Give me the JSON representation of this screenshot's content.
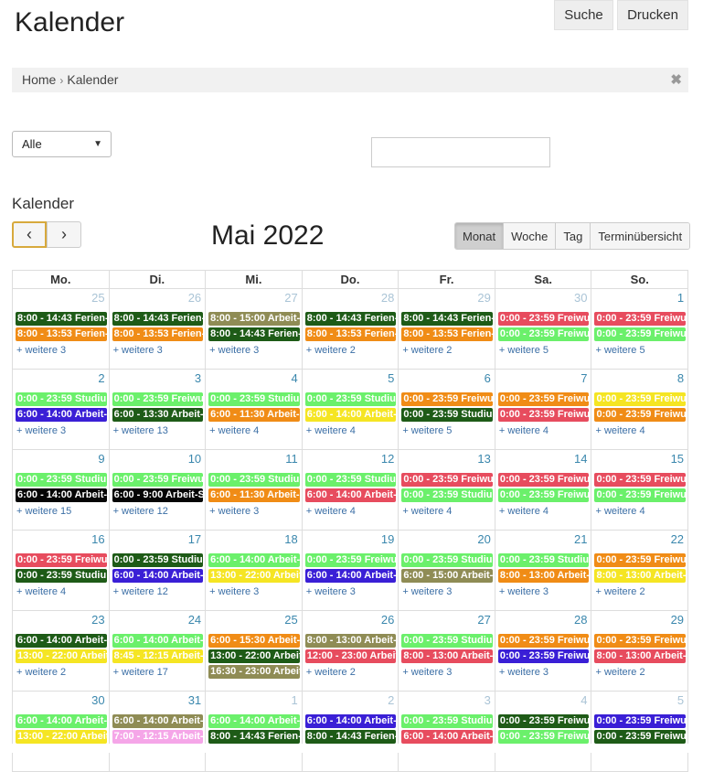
{
  "page": {
    "title": "Kalender"
  },
  "breadcrumb": {
    "home": "Home",
    "current": "Kalender",
    "close_icon": "close-icon"
  },
  "filter": {
    "selected": "Alle"
  },
  "search": {
    "value": "",
    "search_label": "Suche",
    "print_label": "Drucken"
  },
  "calendar": {
    "section_title": "Kalender",
    "month_title": "Mai 2022",
    "views": [
      "Monat",
      "Woche",
      "Tag",
      "Terminübersicht"
    ],
    "active_view": "Monat",
    "weekdays": [
      "Mo.",
      "Di.",
      "Mi.",
      "Do.",
      "Fr.",
      "Sa.",
      "So."
    ],
    "colors": {
      "dkgreen": "#1e5b17",
      "orange": "#f08c16",
      "olive": "#8f8c55",
      "red": "#e74c5e",
      "ltgreen": "#6bf06b",
      "blue": "#3a1fd6",
      "yellow": "#f5e523",
      "black": "#050505",
      "pink": "#f5a6e8"
    },
    "weeks": [
      [
        {
          "n": "25",
          "other": true,
          "events": [
            [
              "8:00 - 14:43 Ferien-",
              "dkgreen"
            ],
            [
              "8:00 - 13:53 Ferien-",
              "orange"
            ]
          ],
          "more": "+ weitere 3"
        },
        {
          "n": "26",
          "other": true,
          "events": [
            [
              "8:00 - 14:43 Ferien-",
              "dkgreen"
            ],
            [
              "8:00 - 13:53 Ferien-",
              "orange"
            ]
          ],
          "more": "+ weitere 3"
        },
        {
          "n": "27",
          "other": true,
          "events": [
            [
              "8:00 - 15:00 Arbeit-",
              "olive"
            ],
            [
              "8:00 - 14:43 Ferien-",
              "dkgreen"
            ]
          ],
          "more": "+ weitere 3"
        },
        {
          "n": "28",
          "other": true,
          "events": [
            [
              "8:00 - 14:43 Ferien-",
              "dkgreen"
            ],
            [
              "8:00 - 13:53 Ferien-",
              "orange"
            ]
          ],
          "more": "+ weitere 2"
        },
        {
          "n": "29",
          "other": true,
          "events": [
            [
              "8:00 - 14:43 Ferien-",
              "dkgreen"
            ],
            [
              "8:00 - 13:53 Ferien-",
              "orange"
            ]
          ],
          "more": "+ weitere 2"
        },
        {
          "n": "30",
          "other": true,
          "events": [
            [
              "0:00 - 23:59 Freiwu",
              "red"
            ],
            [
              "0:00 - 23:59 Freiwu",
              "ltgreen"
            ]
          ],
          "more": "+ weitere 5"
        },
        {
          "n": "1",
          "other": false,
          "events": [
            [
              "0:00 - 23:59 Freiwu",
              "red"
            ],
            [
              "0:00 - 23:59 Freiwu",
              "ltgreen"
            ]
          ],
          "more": "+ weitere 5"
        }
      ],
      [
        {
          "n": "2",
          "other": false,
          "events": [
            [
              "0:00 - 23:59 Studiu",
              "ltgreen"
            ],
            [
              "6:00 - 14:00 Arbeit-",
              "blue"
            ]
          ],
          "more": "+ weitere 3"
        },
        {
          "n": "3",
          "other": false,
          "events": [
            [
              "0:00 - 23:59 Freiwu",
              "ltgreen"
            ],
            [
              "6:00 - 13:30 Arbeit-",
              "dkgreen"
            ]
          ],
          "more": "+ weitere 13"
        },
        {
          "n": "4",
          "other": false,
          "events": [
            [
              "0:00 - 23:59 Studiu",
              "ltgreen"
            ],
            [
              "6:00 - 11:30 Arbeit-",
              "orange"
            ]
          ],
          "more": "+ weitere 4"
        },
        {
          "n": "5",
          "other": false,
          "events": [
            [
              "0:00 - 23:59 Studiu",
              "ltgreen"
            ],
            [
              "6:00 - 14:00 Arbeit-",
              "yellow"
            ]
          ],
          "more": "+ weitere 4"
        },
        {
          "n": "6",
          "other": false,
          "events": [
            [
              "0:00 - 23:59 Freiwu",
              "orange"
            ],
            [
              "0:00 - 23:59 Studiu",
              "dkgreen"
            ]
          ],
          "more": "+ weitere 5"
        },
        {
          "n": "7",
          "other": false,
          "events": [
            [
              "0:00 - 23:59 Freiwu",
              "orange"
            ],
            [
              "0:00 - 23:59 Freiwu",
              "red"
            ]
          ],
          "more": "+ weitere 4"
        },
        {
          "n": "8",
          "other": false,
          "events": [
            [
              "0:00 - 23:59 Freiwu",
              "yellow"
            ],
            [
              "0:00 - 23:59 Freiwu",
              "orange"
            ]
          ],
          "more": "+ weitere 4"
        }
      ],
      [
        {
          "n": "9",
          "other": false,
          "events": [
            [
              "0:00 - 23:59 Studiu",
              "ltgreen"
            ],
            [
              "6:00 - 14:00 Arbeit-S",
              "black"
            ]
          ],
          "more": "+ weitere 15"
        },
        {
          "n": "10",
          "other": false,
          "events": [
            [
              "0:00 - 23:59 Freiwu",
              "ltgreen"
            ],
            [
              "6:00 - 9:00 Arbeit-S",
              "black"
            ]
          ],
          "more": "+ weitere 12"
        },
        {
          "n": "11",
          "other": false,
          "events": [
            [
              "0:00 - 23:59 Studiu",
              "ltgreen"
            ],
            [
              "6:00 - 11:30 Arbeit-",
              "orange"
            ]
          ],
          "more": "+ weitere 3"
        },
        {
          "n": "12",
          "other": false,
          "events": [
            [
              "0:00 - 23:59 Studiu",
              "ltgreen"
            ],
            [
              "6:00 - 14:00 Arbeit-",
              "red"
            ]
          ],
          "more": "+ weitere 4"
        },
        {
          "n": "13",
          "other": false,
          "events": [
            [
              "0:00 - 23:59 Freiwu",
              "red"
            ],
            [
              "0:00 - 23:59 Studiu",
              "ltgreen"
            ]
          ],
          "more": "+ weitere 4"
        },
        {
          "n": "14",
          "other": false,
          "events": [
            [
              "0:00 - 23:59 Freiwu",
              "red"
            ],
            [
              "0:00 - 23:59 Freiwu",
              "ltgreen"
            ]
          ],
          "more": "+ weitere 4"
        },
        {
          "n": "15",
          "other": false,
          "events": [
            [
              "0:00 - 23:59 Freiwu",
              "red"
            ],
            [
              "0:00 - 23:59 Freiwu",
              "ltgreen"
            ]
          ],
          "more": "+ weitere 4"
        }
      ],
      [
        {
          "n": "16",
          "other": false,
          "events": [
            [
              "0:00 - 23:59 Freiwu",
              "red"
            ],
            [
              "0:00 - 23:59 Studiu",
              "dkgreen"
            ]
          ],
          "more": "+ weitere 4"
        },
        {
          "n": "17",
          "other": false,
          "events": [
            [
              "0:00 - 23:59 Studiu",
              "dkgreen"
            ],
            [
              "6:00 - 14:00 Arbeit-",
              "blue"
            ]
          ],
          "more": "+ weitere 12"
        },
        {
          "n": "18",
          "other": false,
          "events": [
            [
              "6:00 - 14:00 Arbeit-",
              "ltgreen"
            ],
            [
              "13:00 - 22:00 Arbeit",
              "yellow"
            ]
          ],
          "more": "+ weitere 3"
        },
        {
          "n": "19",
          "other": false,
          "events": [
            [
              "0:00 - 23:59 Freiwu",
              "ltgreen"
            ],
            [
              "6:00 - 14:00 Arbeit-",
              "blue"
            ]
          ],
          "more": "+ weitere 3"
        },
        {
          "n": "20",
          "other": false,
          "events": [
            [
              "0:00 - 23:59 Studiu",
              "ltgreen"
            ],
            [
              "6:00 - 15:00 Arbeit-",
              "olive"
            ]
          ],
          "more": "+ weitere 3"
        },
        {
          "n": "21",
          "other": false,
          "events": [
            [
              "0:00 - 23:59 Studiu",
              "ltgreen"
            ],
            [
              "8:00 - 13:00 Arbeit-",
              "orange"
            ]
          ],
          "more": "+ weitere 3"
        },
        {
          "n": "22",
          "other": false,
          "events": [
            [
              "0:00 - 23:59 Freiwu",
              "orange"
            ],
            [
              "8:00 - 13:00 Arbeit-",
              "yellow"
            ]
          ],
          "more": "+ weitere 2"
        }
      ],
      [
        {
          "n": "23",
          "other": false,
          "events": [
            [
              "6:00 - 14:00 Arbeit-",
              "dkgreen"
            ],
            [
              "13:00 - 22:00 Arbeit",
              "yellow"
            ]
          ],
          "more": "+ weitere 2"
        },
        {
          "n": "24",
          "other": false,
          "events": [
            [
              "6:00 - 14:00 Arbeit-",
              "ltgreen"
            ],
            [
              "8:45 - 12:15 Arbeit-",
              "yellow"
            ]
          ],
          "more": "+ weitere 17"
        },
        {
          "n": "25",
          "other": false,
          "events": [
            [
              "6:00 - 15:30 Arbeit-",
              "orange"
            ],
            [
              "13:00 - 22:00 Arbeit",
              "dkgreen"
            ],
            [
              "16:30 - 23:00 Arbeit",
              "olive"
            ]
          ],
          "more": ""
        },
        {
          "n": "26",
          "other": false,
          "events": [
            [
              "8:00 - 13:00 Arbeit-",
              "olive"
            ],
            [
              "12:00 - 23:00 Arbeit",
              "red"
            ]
          ],
          "more": "+ weitere 2"
        },
        {
          "n": "27",
          "other": false,
          "events": [
            [
              "0:00 - 23:59 Studiu",
              "ltgreen"
            ],
            [
              "8:00 - 13:00 Arbeit-",
              "red"
            ]
          ],
          "more": "+ weitere 3"
        },
        {
          "n": "28",
          "other": false,
          "events": [
            [
              "0:00 - 23:59 Freiwu",
              "orange"
            ],
            [
              "0:00 - 23:59 Freiwu",
              "blue"
            ]
          ],
          "more": "+ weitere 3"
        },
        {
          "n": "29",
          "other": false,
          "events": [
            [
              "0:00 - 23:59 Freiwu",
              "orange"
            ],
            [
              "8:00 - 13:00 Arbeit-",
              "red"
            ]
          ],
          "more": "+ weitere 2"
        }
      ],
      [
        {
          "n": "30",
          "other": false,
          "events": [
            [
              "6:00 - 14:00 Arbeit-",
              "ltgreen"
            ],
            [
              "13:00 - 22:00 Arbeit",
              "yellow"
            ]
          ],
          "more": ""
        },
        {
          "n": "31",
          "other": false,
          "events": [
            [
              "6:00 - 14:00 Arbeit-",
              "olive"
            ],
            [
              "7:00 - 12:15 Arbeit-",
              "pink"
            ]
          ],
          "more": ""
        },
        {
          "n": "1",
          "other": true,
          "events": [
            [
              "6:00 - 14:00 Arbeit-",
              "ltgreen"
            ],
            [
              "8:00 - 14:43 Ferien-",
              "dkgreen"
            ]
          ],
          "more": ""
        },
        {
          "n": "2",
          "other": true,
          "events": [
            [
              "6:00 - 14:00 Arbeit-",
              "blue"
            ],
            [
              "8:00 - 14:43 Ferien-",
              "dkgreen"
            ]
          ],
          "more": ""
        },
        {
          "n": "3",
          "other": true,
          "events": [
            [
              "0:00 - 23:59 Studiu",
              "ltgreen"
            ],
            [
              "6:00 - 14:00 Arbeit-",
              "red"
            ]
          ],
          "more": ""
        },
        {
          "n": "4",
          "other": true,
          "events": [
            [
              "0:00 - 23:59 Freiwu",
              "dkgreen"
            ],
            [
              "0:00 - 23:59 Freiwu",
              "ltgreen"
            ]
          ],
          "more": ""
        },
        {
          "n": "5",
          "other": true,
          "events": [
            [
              "0:00 - 23:59 Freiwu",
              "blue"
            ],
            [
              "0:00 - 23:59 Freiwu",
              "dkgreen"
            ]
          ],
          "more": ""
        }
      ]
    ]
  }
}
